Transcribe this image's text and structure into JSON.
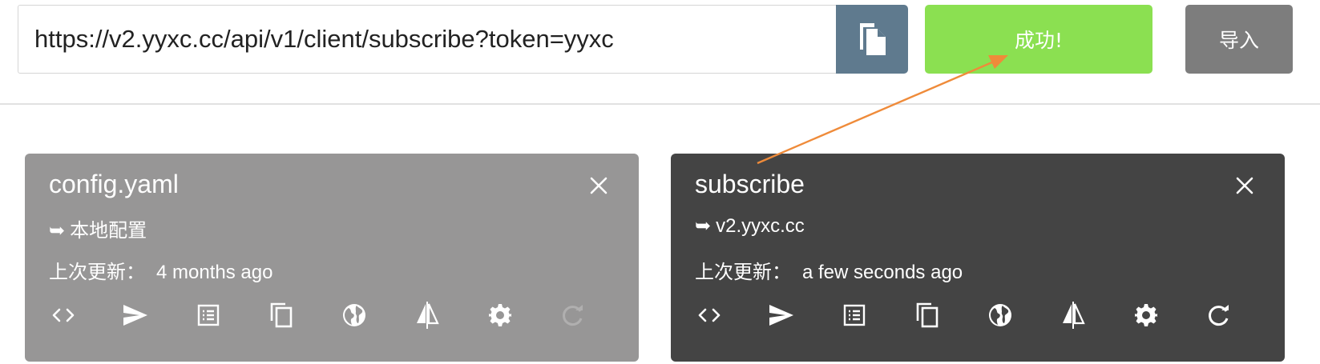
{
  "toolbar": {
    "url_input_value": "https://v2.yyxc.cc/api/v1/client/subscribe?token=yyxc",
    "status_label": "成功!",
    "import_label": "导入",
    "colors": {
      "copy_button_bg": "#5f7a8e",
      "status_button_bg": "#8be051",
      "import_button_bg": "#7d7d7d"
    }
  },
  "profiles": [
    {
      "title": "config.yaml",
      "source_arrow": "➥",
      "source": "本地配置",
      "updated_label": "上次更新：",
      "updated_value": "4 months ago",
      "active": false,
      "bg": "#979696"
    },
    {
      "title": "subscribe",
      "source_arrow": "➥",
      "source": "v2.yyxc.cc",
      "updated_label": "上次更新：",
      "updated_value": "a few seconds ago",
      "active": true,
      "bg": "#444444"
    }
  ],
  "card_action_icons": [
    "code-icon",
    "send-icon",
    "list-icon",
    "copy-icon",
    "globe-icon",
    "flip-icon",
    "gear-icon",
    "refresh-icon"
  ],
  "annotation": {
    "arrow_color": "#ef8b3a"
  }
}
